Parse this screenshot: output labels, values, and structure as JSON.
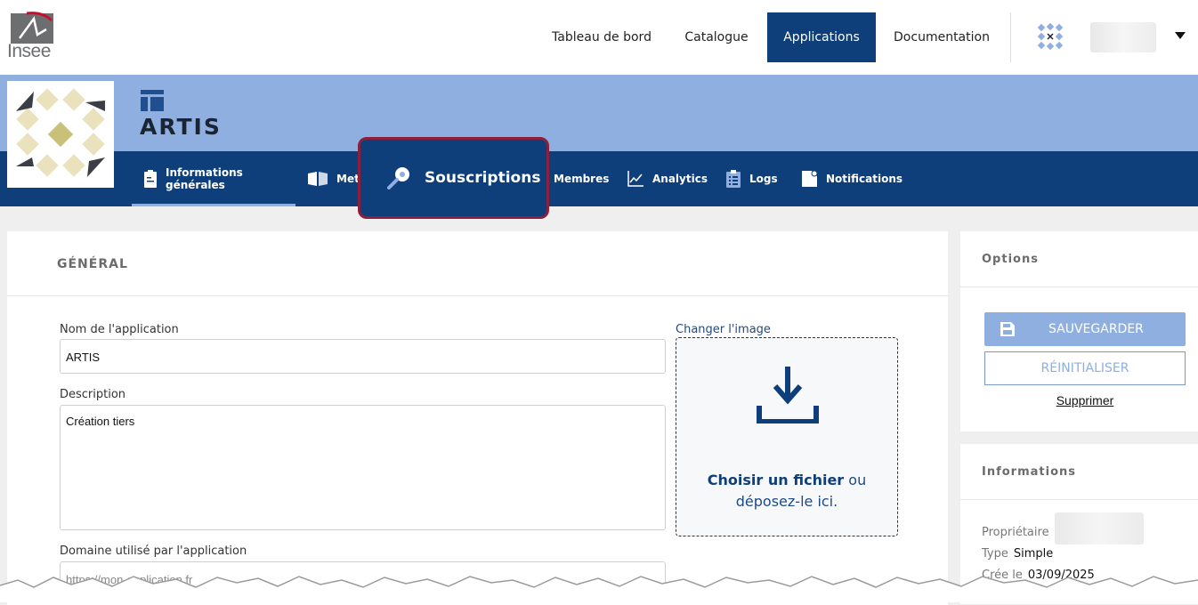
{
  "brand": {
    "logo_text": "Insee"
  },
  "nav": {
    "items": [
      "Tableau de bord",
      "Catalogue",
      "Applications",
      "Documentation"
    ],
    "active": "Applications"
  },
  "app": {
    "title": "ARTIS",
    "tabs": [
      {
        "label": "Informations générales",
        "icon": "clipboard-icon"
      },
      {
        "label": "Meta",
        "icon": "book-icon"
      },
      {
        "label": "Souscriptions",
        "icon": "key-icon"
      },
      {
        "label": "Membres",
        "icon": "users-icon"
      },
      {
        "label": "Analytics",
        "icon": "chart-line-icon"
      },
      {
        "label": "Logs",
        "icon": "list-icon"
      },
      {
        "label": "Notifications",
        "icon": "bell-icon"
      }
    ]
  },
  "general": {
    "title": "GÉNÉRAL",
    "name_label": "Nom de l'application",
    "name_value": "ARTIS",
    "description_label": "Description",
    "description_value": "Création tiers",
    "domain_label": "Domaine utilisé par l'application",
    "domain_placeholder": "https://mon-application.fr",
    "change_image": "Changer l'image",
    "dropzone_choose": "Choisir un fichier",
    "dropzone_or": " ou",
    "dropzone_drop": "déposez-le ici."
  },
  "options": {
    "title": "Options",
    "save": "SAUVEGARDER",
    "reset": "RÉINITIALISER",
    "delete": "Supprimer"
  },
  "informations": {
    "title": "Informations",
    "owner_label": "Propriétaire",
    "type_label": "Type",
    "type_value": "Simple",
    "created_label": "Crée le",
    "created_value": "03/09/2025"
  },
  "colors": {
    "primary": "#0e3f7a",
    "light": "#8eafe0",
    "highlight_border": "#8b1f3c"
  }
}
